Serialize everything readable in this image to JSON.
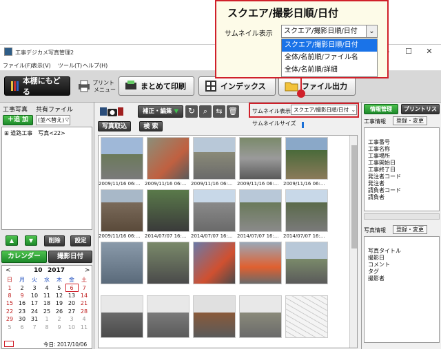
{
  "window": {
    "title": "工事デジカメ写真管理2",
    "controls": [
      "—",
      "☐",
      "✕"
    ]
  },
  "menu": [
    "ファイル(F)",
    "表示(V)",
    "ツール(T)",
    "ヘルプ(H)"
  ],
  "toolbar": {
    "back": "本棚にもどる",
    "print_menu_line1": "プリント",
    "print_menu_line2": "メニュー",
    "batch_print": "まとめて印刷",
    "index": "インデックス",
    "file_output": "ファイル出力"
  },
  "left": {
    "tab_photos": "工事写真",
    "tab_shared": "共有ファイル",
    "add": "追 加",
    "sort": "(並べ替え)",
    "tree_item": "道路工事　写真<22>",
    "up": "▲",
    "down": "▼",
    "delete": "削除",
    "settings": "設定",
    "calendar": "カレンダー",
    "shoot_date": "撮影日付"
  },
  "calendar": {
    "prev": "<",
    "next": ">",
    "month": "10",
    "year": "2017",
    "weekdays": [
      "日",
      "月",
      "火",
      "水",
      "木",
      "金",
      "土"
    ],
    "weeks": [
      [
        "1",
        "2",
        "3",
        "4",
        "5",
        "6",
        "7"
      ],
      [
        "8",
        "9",
        "10",
        "11",
        "12",
        "13",
        "14"
      ],
      [
        "15",
        "16",
        "17",
        "18",
        "19",
        "20",
        "21"
      ],
      [
        "22",
        "23",
        "24",
        "25",
        "26",
        "27",
        "28"
      ],
      [
        "29",
        "30",
        "31",
        "1",
        "2",
        "3",
        "4"
      ],
      [
        "5",
        "6",
        "7",
        "8",
        "9",
        "10",
        "11"
      ]
    ],
    "today_label": "今日: 2017/10/06"
  },
  "center": {
    "fix_edit": "補正・編集",
    "photo_import": "写真取込",
    "search": "検 索",
    "thumb_display_label": "サムネイル表示",
    "thumb_display_value": "スクエア/撮影日順/日付",
    "thumb_size_label": "サムネイルサイズ"
  },
  "thumbnails": {
    "row1": [
      "2009/11/16 06:...",
      "2009/11/16 06:...",
      "2009/11/16 06:...",
      "2009/11/16 06:...",
      "2009/11/16 06:..."
    ],
    "row2": [
      "2009/11/16 06:...",
      "2014/07/07 16:...",
      "2014/07/07 16:...",
      "2014/07/07 16:...",
      "2014/07/07 16:..."
    ]
  },
  "right": {
    "info_tab": "情報管理",
    "print_list_tab": "プリントリスト",
    "project_info": "工事情報",
    "register_change": "登録・変更",
    "project_fields": [
      "工事番号",
      "工事名称",
      "工事場所",
      "工事開始日",
      "工事終了日",
      "発注者コード",
      "発注者",
      "請負者コード",
      "請負者"
    ],
    "photo_info": "写真情報",
    "photo_fields": [
      "写真タイトル",
      "撮影日",
      "コメント",
      "タグ",
      "撮影者"
    ]
  },
  "callout": {
    "title": "スクエア/撮影日順/日付",
    "label": "サムネイル表示",
    "selected": "スクエア/撮影日順/日付",
    "options": [
      "スクエア/撮影日順/日付",
      "全体/名前順/ファイル名",
      "全体/名前順/詳細"
    ]
  },
  "colors": {
    "accent_red": "#d0202a",
    "green": "#1c8a2a",
    "selection_blue": "#1a73e8"
  }
}
